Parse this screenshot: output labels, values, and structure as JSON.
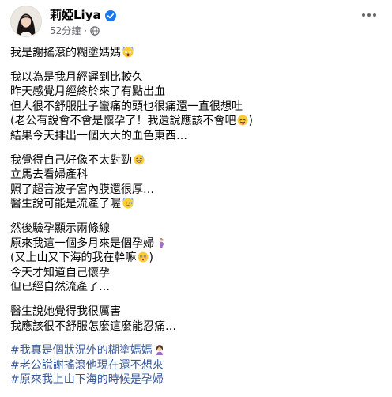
{
  "author": {
    "name": "莉婭Liya",
    "time": "52分鐘",
    "separator": "·"
  },
  "post": {
    "paragraphs": [
      {
        "lines": [
          {
            "text": "我是謝搖滾的糊塗媽媽",
            "emoji": "fearful-face"
          }
        ]
      },
      {
        "lines": [
          {
            "text": "我以為是我月經遲到比較久"
          },
          {
            "text": "昨天感覺月經終於來了有點出血"
          },
          {
            "text": "但人很不舒服肚子蠻痛的頭也很痛還一直很想吐"
          },
          {
            "text": "(老公有說會不會是懷孕了！我還說應該不會吧",
            "emoji": "tongue-face",
            "suffix": ")"
          },
          {
            "text": "結果今天排出一個大大的血色東西…"
          }
        ]
      },
      {
        "lines": [
          {
            "text": "我覺得自己好像不太對勁",
            "emoji": "grin-sweat"
          },
          {
            "text": "立馬去看婦產科"
          },
          {
            "text": "照了超音波子宮內膜還很厚…"
          },
          {
            "text": "醫生說可能是流產了喔",
            "emoji": "anxious-face"
          }
        ]
      },
      {
        "lines": [
          {
            "text": "然後驗孕顯示兩條線"
          },
          {
            "text": "原來我這一個多月來是個孕婦",
            "emoji": "pregnant-woman"
          },
          {
            "text": "(又上山又下海的我在幹嘛",
            "emoji": "flushed-face",
            "suffix": ")"
          },
          {
            "text": "今天才知道自己懷孕"
          },
          {
            "text": "但已經自然流產了…"
          }
        ]
      },
      {
        "lines": [
          {
            "text": "醫生說她覺得我很厲害"
          },
          {
            "text": "我應該很不舒服怎麼這麼能忍痛…"
          }
        ]
      }
    ],
    "hashtags": [
      {
        "text": "#我真是個狀況外的糊塗媽媽",
        "emoji": "facepalm-woman"
      },
      {
        "text": "#老公說謝搖滾他現在還不想來"
      },
      {
        "text": "#原來我上山下海的時候是孕婦"
      }
    ]
  },
  "colors": {
    "link": "#385898",
    "meta": "#65676b",
    "verified": "#1877f2"
  }
}
